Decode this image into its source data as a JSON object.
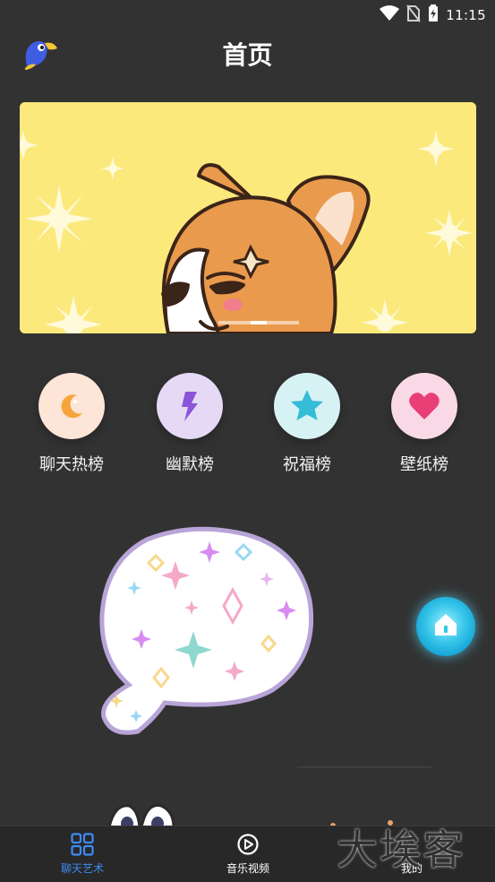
{
  "status_bar": {
    "time": "11:15",
    "icons": [
      "wifi-icon",
      "no-sim-icon",
      "battery-icon"
    ]
  },
  "header": {
    "title": "首页",
    "logo_icon": "parrot-logo-icon"
  },
  "banner": {
    "background_color": "#fbe97c",
    "slide_count": 3,
    "active_slide": 2
  },
  "categories": [
    {
      "label": "聊天热榜",
      "icon": "moon-icon",
      "bg": "#fde5d7",
      "icon_color": "#f6a53b"
    },
    {
      "label": "幽默榜",
      "icon": "lightning-icon",
      "bg": "#e6d9f6",
      "icon_color": "#8b54d9"
    },
    {
      "label": "祝福榜",
      "icon": "star-icon",
      "bg": "#d7f2f4",
      "icon_color": "#35bcd6"
    },
    {
      "label": "壁纸榜",
      "icon": "heart-icon",
      "bg": "#fad9e6",
      "icon_color": "#e83f77"
    }
  ],
  "floating_button": {
    "icon": "home-icon"
  },
  "tab_bar": {
    "tabs": [
      {
        "label": "聊天艺术",
        "icon": "grid-icon",
        "active": true
      },
      {
        "label": "音乐视频",
        "icon": "play-icon",
        "active": false
      },
      {
        "label": "我的",
        "icon": "profile-icon",
        "active": false
      }
    ],
    "active_color": "#3d8bf5"
  },
  "watermark": {
    "text": "大埃客"
  }
}
